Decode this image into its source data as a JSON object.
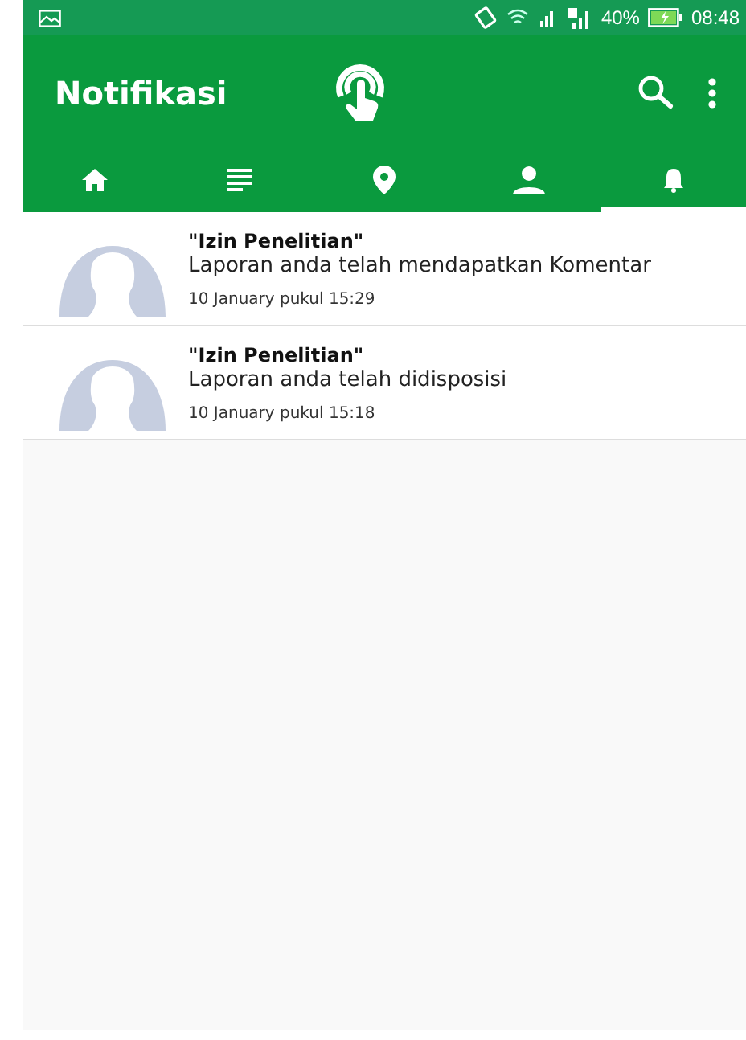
{
  "status_bar": {
    "battery": "40%",
    "time": "08:48"
  },
  "toolbar": {
    "title": "Notifikasi"
  },
  "tabs": [
    {
      "kind": "home",
      "selected": false
    },
    {
      "kind": "list",
      "selected": false
    },
    {
      "kind": "pin",
      "selected": false
    },
    {
      "kind": "person",
      "selected": false
    },
    {
      "kind": "bell",
      "selected": true
    }
  ],
  "notifications": [
    {
      "title": "\"Izin Penelitian\"",
      "message": "Laporan anda telah mendapatkan Komentar",
      "time": "10 January pukul 15:29"
    },
    {
      "title": "\"Izin Penelitian\"",
      "message": "Laporan anda telah didisposisi",
      "time": "10 January pukul 15:18"
    }
  ]
}
